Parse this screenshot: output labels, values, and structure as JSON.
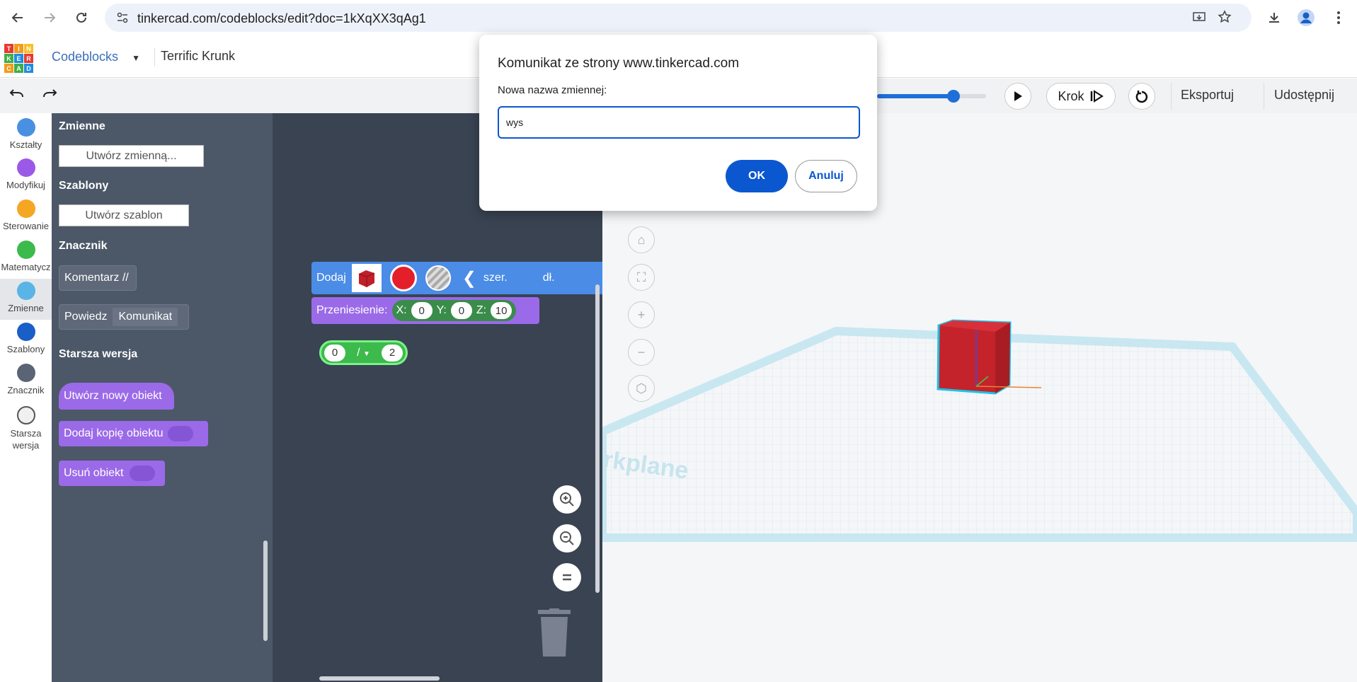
{
  "browser": {
    "url": "tinkercad.com/codeblocks/edit?doc=1kXqXX3qAg1"
  },
  "header": {
    "logo_letters": [
      "T",
      "I",
      "N",
      "K",
      "E",
      "R",
      "C",
      "A",
      "D"
    ],
    "mode_label": "Codeblocks",
    "project_name": "Terrific Krunk"
  },
  "toolbar": {
    "step_label": "Krok",
    "export_label": "Eksportuj",
    "share_label": "Udostępnij",
    "speed_value": 0.7
  },
  "categories": [
    {
      "label": "Kształty",
      "color": "#4a90e2"
    },
    {
      "label": "Modyfikuj",
      "color": "#9b59e8"
    },
    {
      "label": "Sterowanie",
      "color": "#f5a623"
    },
    {
      "label": "Matematycz",
      "color": "#3cba4c"
    },
    {
      "label": "Zmienne",
      "color": "#5ab4e6"
    },
    {
      "label": "Szablony",
      "color": "#1a5fc8"
    },
    {
      "label": "Znacznik",
      "color": "#5a6474"
    },
    {
      "label": "Starsza wersja",
      "color": "#f0f0f0"
    }
  ],
  "flyout": {
    "vars_heading": "Zmienne",
    "create_var_button": "Utwórz zmienną...",
    "templates_heading": "Szablony",
    "create_template_button": "Utwórz szablon",
    "marker_heading": "Znacznik",
    "comment_block": "Komentarz //",
    "say_block": "Powiedz",
    "say_value": "Komunikat",
    "legacy_heading": "Starsza wersja",
    "new_object_block": "Utwórz nowy obiekt",
    "copy_object_block": "Dodaj kopię obiektu",
    "remove_object_block": "Usuń obiekt"
  },
  "workspace": {
    "add_block": "Dodaj",
    "width_label": "szer.",
    "length_label": "dł.",
    "move_block": "Przeniesienie:",
    "x_label": "X:",
    "x_value": "0",
    "y_label": "Y:",
    "y_value": "0",
    "z_label": "Z:",
    "z_value": "10",
    "div_left": "0",
    "div_op": "/",
    "div_right": "2"
  },
  "canvas": {
    "workplane_label": "rkplane"
  },
  "dialog": {
    "title": "Komunikat ze strony www.tinkercad.com",
    "prompt": "Nowa nazwa zmiennej:",
    "input_value": "wys",
    "ok_label": "OK",
    "cancel_label": "Anuluj"
  }
}
